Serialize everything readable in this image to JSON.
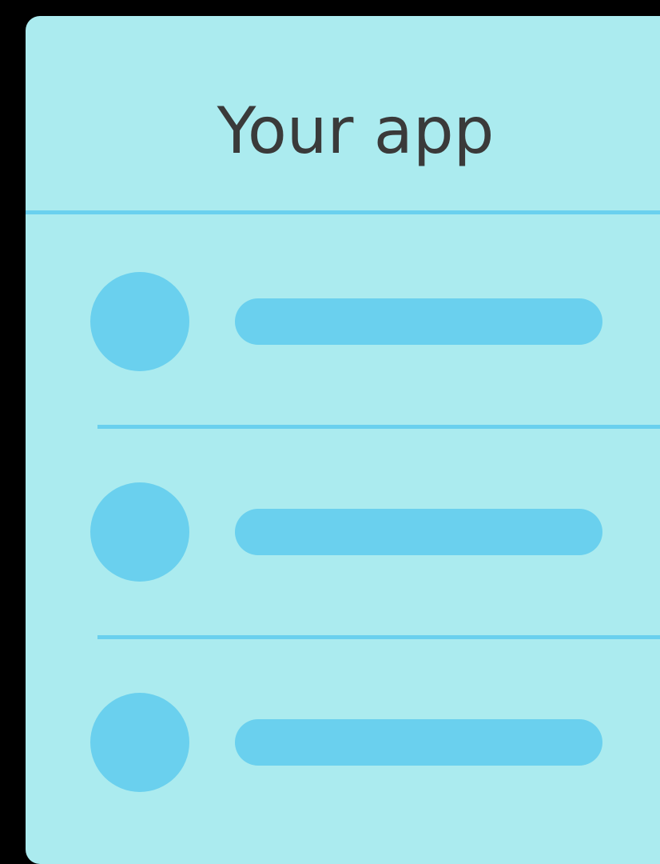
{
  "app": {
    "title": "Your app"
  },
  "colors": {
    "background": "#000000",
    "card": "#abebef",
    "accent": "#6ad0ee",
    "title_text": "#3a3a3a"
  },
  "list": {
    "items": [
      {
        "avatar_icon": "placeholder-circle-icon"
      },
      {
        "avatar_icon": "placeholder-circle-icon"
      },
      {
        "avatar_icon": "placeholder-circle-icon"
      }
    ]
  }
}
